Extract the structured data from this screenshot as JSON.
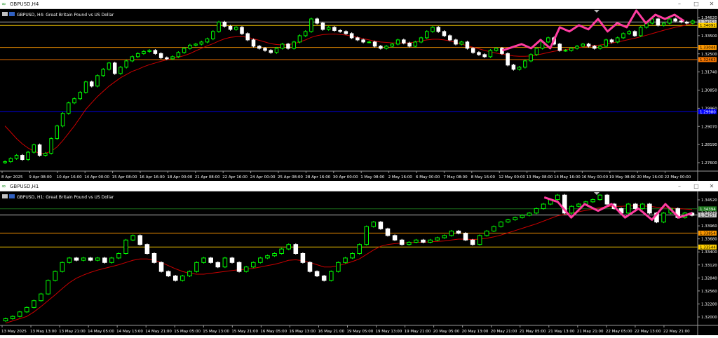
{
  "windows": [
    {
      "title": "GBPUSD,H4",
      "symbol_info": "GBPUSD, H4:  Great Britain Pound vs US Dollar",
      "price_labels": [
        "1.34620",
        "1.33500",
        "1.32500",
        "1.31740",
        "1.30850",
        "1.29960",
        "1.29070",
        "1.28190",
        "1.27600"
      ],
      "x_labels": [
        "8 Apr 2025",
        "9 Apr 08:00",
        "10 Apr 16:00",
        "14 Apr 00:00",
        "15 Apr 08:00",
        "16 Apr 16:00",
        "18 Apr 00:00",
        "21 Apr 08:00",
        "22 Apr 16:00",
        "24 Apr 00:00",
        "25 Apr 08:00",
        "28 Apr 16:00",
        "30 Apr 00:00",
        "1 May 08:00",
        "2 May 16:00",
        "6 May 00:00",
        "7 May 08:00",
        "8 May 16:00",
        "12 May 00:00",
        "13 May 08:00",
        "14 May 16:00",
        "16 May 00:00",
        "19 May 08:00",
        "20 May 16:00",
        "22 May 00:00"
      ],
      "level_tags": [
        {
          "text": "1.34252",
          "color": "#c8c8c8",
          "text_color": "#000000"
        },
        {
          "text": "1.34091",
          "color": "#ffd000",
          "text_color": "#000000"
        },
        {
          "text": "1.33044",
          "color": "#ff9900",
          "text_color": "#000000"
        },
        {
          "text": "1.32463",
          "color": "#ff7a00",
          "text_color": "#000000"
        },
        {
          "text": "1.29980",
          "color": "#0000ff",
          "text_color": "#ffffff"
        }
      ]
    },
    {
      "title": "GBPUSD,H1",
      "symbol_info": "GBPUSD, H1:  Great Britain Pound vs US Dollar",
      "price_labels": [
        "1.34520",
        "1.34240",
        "1.33960",
        "1.33680",
        "1.33400",
        "1.33120",
        "1.32840",
        "1.32560",
        "1.32280",
        "1.32000"
      ],
      "x_labels": [
        "13 May 2025",
        "13 May 13:00",
        "13 May 21:00",
        "14 May 05:00",
        "14 May 13:00",
        "14 May 21:00",
        "15 May 05:00",
        "15 May 13:00",
        "15 May 21:00",
        "16 May 05:00",
        "16 May 13:00",
        "16 May 21:00",
        "19 May 05:00",
        "19 May 13:00",
        "19 May 21:00",
        "20 May 05:00",
        "20 May 13:00",
        "20 May 21:00",
        "21 May 05:00",
        "21 May 13:00",
        "21 May 21:00",
        "22 May 05:00",
        "22 May 13:00",
        "22 May 21:00"
      ],
      "level_tags": [
        {
          "text": "1.34394",
          "color": "#1f7a1f",
          "text_color": "#ffffff"
        },
        {
          "text": "1.34257",
          "color": "#c8c8c8",
          "text_color": "#000000"
        },
        {
          "text": "1.33854",
          "color": "#ff9900",
          "text_color": "#000000"
        },
        {
          "text": "1.33544",
          "color": "#ffd000",
          "text_color": "#000000"
        }
      ]
    }
  ],
  "chart_data": [
    {
      "type": "candlestick",
      "title": "GBPUSD, H4:  Great Britain Pound vs US Dollar",
      "ylim": [
        1.2715,
        1.348
      ],
      "up_color": "#00ff00",
      "down_color": "#ffffff",
      "ma_color": "#cc0000",
      "pattern_color": "#ff3ca0",
      "closes": [
        1.276,
        1.2775,
        1.279,
        1.277,
        1.2805,
        1.284,
        1.279,
        1.28,
        1.287,
        1.293,
        1.299,
        1.304,
        1.306,
        1.309,
        1.314,
        1.312,
        1.317,
        1.32,
        1.323,
        1.318,
        1.321,
        1.324,
        1.326,
        1.3275,
        1.3285,
        1.329,
        1.3275,
        1.3255,
        1.325,
        1.326,
        1.328,
        1.33,
        1.3315,
        1.332,
        1.333,
        1.3345,
        1.338,
        1.3425,
        1.3405,
        1.339,
        1.34,
        1.337,
        1.334,
        1.331,
        1.33,
        1.329,
        1.328,
        1.33,
        1.332,
        1.33,
        1.333,
        1.336,
        1.338,
        1.344,
        1.342,
        1.339,
        1.34,
        1.3385,
        1.338,
        1.337,
        1.335,
        1.334,
        1.333,
        1.333,
        1.331,
        1.33,
        1.331,
        1.332,
        1.334,
        1.3325,
        1.331,
        1.333,
        1.335,
        1.338,
        1.34,
        1.338,
        1.336,
        1.334,
        1.332,
        1.333,
        1.33,
        1.328,
        1.327,
        1.326,
        1.329,
        1.33,
        1.3275,
        1.322,
        1.32,
        1.321,
        1.324,
        1.327,
        1.33,
        1.333,
        1.335,
        1.332,
        1.329,
        1.329,
        1.33,
        1.331,
        1.332,
        1.331,
        1.33,
        1.331,
        1.334,
        1.333,
        1.335,
        1.337,
        1.338,
        1.336,
        1.34,
        1.342,
        1.344,
        1.341,
        1.342,
        1.344,
        1.343,
        1.3425,
        1.342,
        1.343
      ],
      "moving_average": [
        1.293,
        1.29,
        1.287,
        1.2845,
        1.2825,
        1.281,
        1.28,
        1.28,
        1.281,
        1.283,
        1.286,
        1.2895,
        1.293,
        1.297,
        1.301,
        1.304,
        1.307,
        1.3095,
        1.312,
        1.314,
        1.316,
        1.3175,
        1.319,
        1.32,
        1.3212,
        1.3222,
        1.323,
        1.3238,
        1.3245,
        1.3252,
        1.3258,
        1.3265,
        1.3275,
        1.3288,
        1.33,
        1.3312,
        1.3322,
        1.3335,
        1.3345,
        1.3352,
        1.3355,
        1.3356,
        1.3352,
        1.3345,
        1.3338,
        1.333,
        1.3322,
        1.3318,
        1.3316,
        1.3318,
        1.3322,
        1.333,
        1.334,
        1.3352,
        1.336,
        1.3365,
        1.3367,
        1.3368,
        1.3366,
        1.3363,
        1.3358,
        1.3352,
        1.3346,
        1.334,
        1.3334,
        1.333,
        1.3328,
        1.3326,
        1.3325,
        1.3325,
        1.3326,
        1.333,
        1.3335,
        1.334,
        1.3343,
        1.3343,
        1.334,
        1.3335,
        1.3328,
        1.332,
        1.3312,
        1.3305,
        1.3298,
        1.329,
        1.3283,
        1.3277,
        1.3272,
        1.3268,
        1.3264,
        1.3262,
        1.3262,
        1.3264,
        1.3268,
        1.3274,
        1.328,
        1.3286,
        1.329,
        1.3294,
        1.3298,
        1.3302,
        1.3306,
        1.331,
        1.3313,
        1.3316,
        1.332,
        1.3325,
        1.333,
        1.3336,
        1.3342,
        1.3348,
        1.3355,
        1.3362,
        1.337,
        1.3378,
        1.3386,
        1.3393,
        1.34,
        1.3406,
        1.3412,
        1.3418
      ],
      "pattern": [
        [
          104,
          1.329
        ],
        [
          108,
          1.332
        ],
        [
          110,
          1.33
        ],
        [
          112,
          1.334
        ],
        [
          114,
          1.33
        ],
        [
          116,
          1.34
        ],
        [
          118,
          1.338
        ],
        [
          120,
          1.341
        ],
        [
          122,
          1.339
        ],
        [
          124,
          1.344
        ],
        [
          126,
          1.338
        ],
        [
          128,
          1.342
        ],
        [
          130,
          1.34
        ],
        [
          132,
          1.348
        ],
        [
          134,
          1.342
        ],
        [
          136,
          1.346
        ],
        [
          138,
          1.344
        ],
        [
          140,
          1.346
        ],
        [
          142,
          1.343
        ]
      ],
      "levels": [
        1.34252,
        1.34091,
        1.33044,
        1.32463,
        1.2998
      ]
    },
    {
      "type": "candlestick",
      "title": "GBPUSD, H1:  Great Britain Pound vs US Dollar",
      "ylim": [
        1.318,
        1.3475
      ],
      "up_color": "#00ff00",
      "down_color": "#ffffff",
      "ma_color": "#cc0000",
      "pattern_color": "#ff3ca0",
      "closes": [
        1.3195,
        1.32,
        1.321,
        1.322,
        1.3235,
        1.325,
        1.328,
        1.33,
        1.332,
        1.333,
        1.3325,
        1.333,
        1.3325,
        1.333,
        1.332,
        1.333,
        1.334,
        1.337,
        1.338,
        1.336,
        1.334,
        1.332,
        1.33,
        1.329,
        1.328,
        1.329,
        1.33,
        1.332,
        1.333,
        1.332,
        1.331,
        1.333,
        1.332,
        1.33,
        1.331,
        1.332,
        1.333,
        1.3335,
        1.334,
        1.335,
        1.336,
        1.334,
        1.332,
        1.33,
        1.329,
        1.328,
        1.33,
        1.332,
        1.333,
        1.334,
        1.336,
        1.34,
        1.341,
        1.3395,
        1.338,
        1.337,
        1.336,
        1.3365,
        1.337,
        1.3365,
        1.337,
        1.3375,
        1.338,
        1.339,
        1.3385,
        1.337,
        1.336,
        1.338,
        1.339,
        1.34,
        1.341,
        1.3415,
        1.342,
        1.3425,
        1.343,
        1.344,
        1.345,
        1.346,
        1.347,
        1.343,
        1.3445,
        1.345,
        1.3455,
        1.346,
        1.347,
        1.345,
        1.344,
        1.343,
        1.345,
        1.344,
        1.345,
        1.343,
        1.341,
        1.343,
        1.344,
        1.342,
        1.343,
        1.3425
      ],
      "moving_average": [
        1.3185,
        1.319,
        1.3195,
        1.32,
        1.321,
        1.3222,
        1.3235,
        1.3248,
        1.3262,
        1.3275,
        1.3285,
        1.3292,
        1.3298,
        1.3303,
        1.3307,
        1.3311,
        1.3315,
        1.332,
        1.3325,
        1.3328,
        1.3328,
        1.3325,
        1.332,
        1.3313,
        1.3306,
        1.33,
        1.3296,
        1.3294,
        1.3294,
        1.3296,
        1.3298,
        1.33,
        1.3302,
        1.3304,
        1.3305,
        1.3307,
        1.331,
        1.3313,
        1.3316,
        1.332,
        1.3325,
        1.3326,
        1.3324,
        1.332,
        1.3315,
        1.331,
        1.331,
        1.3313,
        1.3317,
        1.3322,
        1.3328,
        1.3338,
        1.3348,
        1.3356,
        1.336,
        1.3362,
        1.3363,
        1.3364,
        1.3365,
        1.3365,
        1.3366,
        1.3367,
        1.3368,
        1.337,
        1.3372,
        1.3372,
        1.3371,
        1.3372,
        1.3374,
        1.3377,
        1.3381,
        1.3386,
        1.3391,
        1.3396,
        1.3401,
        1.3406,
        1.3412,
        1.3418,
        1.3424,
        1.3427,
        1.343,
        1.3433,
        1.3436,
        1.3439,
        1.3442,
        1.3444,
        1.3445,
        1.3445,
        1.3446,
        1.3446,
        1.3446,
        1.3445,
        1.3443,
        1.3442,
        1.3441,
        1.344,
        1.3439,
        1.3438
      ],
      "pattern": [
        [
          80,
          1.3465
        ],
        [
          82,
          1.3455
        ],
        [
          84,
          1.342
        ],
        [
          86,
          1.345
        ],
        [
          88,
          1.3435
        ],
        [
          90,
          1.345
        ],
        [
          92,
          1.342
        ],
        [
          94,
          1.344
        ],
        [
          96,
          1.3415
        ],
        [
          98,
          1.345
        ],
        [
          100,
          1.342
        ],
        [
          102,
          1.343
        ]
      ],
      "levels": [
        1.34394,
        1.34257,
        1.33854,
        1.33544
      ]
    }
  ]
}
